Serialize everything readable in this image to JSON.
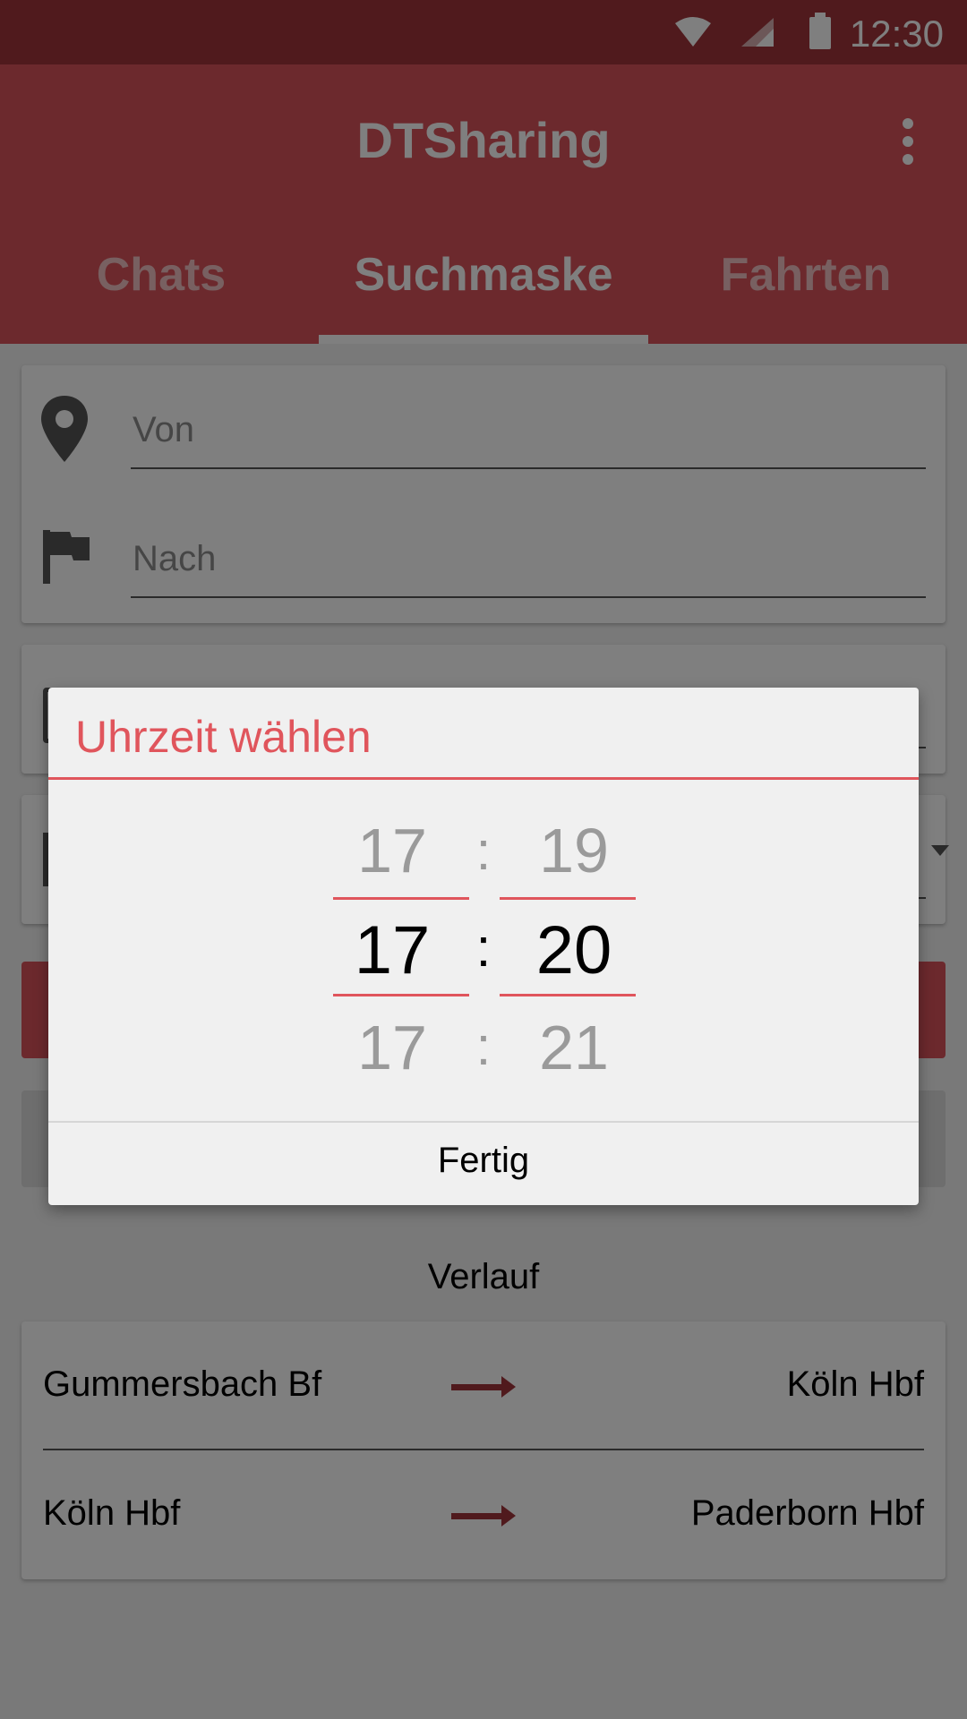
{
  "status": {
    "time": "12:30"
  },
  "appbar": {
    "title": "DTSharing"
  },
  "tabs": [
    {
      "label": "Chats",
      "active": false
    },
    {
      "label": "Suchmaske",
      "active": true
    },
    {
      "label": "Fahrten",
      "active": false
    }
  ],
  "search": {
    "from_placeholder": "Von",
    "to_placeholder": "Nach"
  },
  "history": {
    "title": "Verlauf",
    "rows": [
      {
        "from": "Gummersbach Bf",
        "to": "Köln Hbf"
      },
      {
        "from": "Köln Hbf",
        "to": "Paderborn Hbf"
      }
    ]
  },
  "dialog": {
    "title": "Uhrzeit wählen",
    "hours": [
      "17",
      "17",
      "17"
    ],
    "minutes": [
      "19",
      "20",
      "21"
    ],
    "separator": ":",
    "done_label": "Fertig"
  },
  "colors": {
    "primary": "#d9535a",
    "primary_dark": "#a0353a",
    "accent": "#e0555c"
  }
}
